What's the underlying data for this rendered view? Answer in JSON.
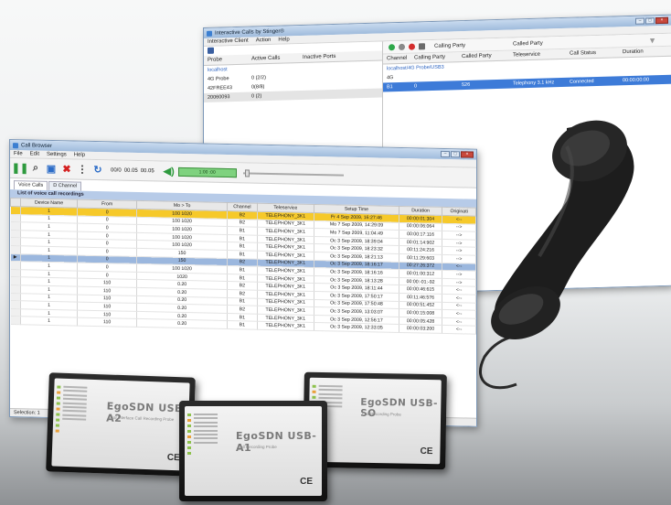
{
  "interactive": {
    "title": "Interactive Calls by Stinger®",
    "menu": [
      "Interactive Client",
      "Action",
      "Help"
    ],
    "left_headers": [
      "Probe",
      "Active Calls",
      "Inactive Ports"
    ],
    "left_rows": [
      {
        "probe": "localhost",
        "active": "",
        "inactive": ""
      },
      {
        "probe": "4G Probe",
        "active": "0 (2/2)",
        "inactive": ""
      },
      {
        "probe": "42FREE43",
        "active": "0(8/8)",
        "inactive": ""
      },
      {
        "probe": "20060093",
        "active": "0 (2)",
        "inactive": ""
      }
    ],
    "right_toolbar_label": "Calling Party",
    "right_filter_label": "Called Party",
    "right_headers": [
      "Channel",
      "Calling Party",
      "Called Party",
      "Teleservice",
      "Call Status",
      "Duration"
    ],
    "right_group": "localhost/4G Probe/USB3",
    "right_sub": "4G",
    "right_selected": {
      "channel": "B1",
      "calling": "0",
      "called": "526",
      "teleservice": "Telephony 3.1 kHz",
      "status": "Connected",
      "duration": "00:00:00:00"
    }
  },
  "callbrowser": {
    "title": "Call Browser",
    "menu": [
      "File",
      "Edit",
      "Settings",
      "Help"
    ],
    "toolbar_counters": [
      "00/0",
      "00.05",
      "00.05"
    ],
    "led_text": "1:00 :00",
    "tabs": [
      "Voice Calls",
      "D Channel"
    ],
    "grid_caption": "List of voice call recordings",
    "headers": [
      "Device Name",
      "From",
      "Mo > To",
      "Channel",
      "Teleservice",
      "Setup Time",
      "Duration",
      "Originati"
    ],
    "rows": [
      [
        "1",
        "0",
        "100 1020",
        "B2",
        "TELEPHONY_3K1",
        "Fr 4 Sep 2009, 16:27:46",
        "00:00:01:304",
        "<--",
        "hl"
      ],
      [
        "1",
        "0",
        "100 1020",
        "B2",
        "TELEPHONY_3K1",
        "Mo 7 Sep 2009, 14:29:09",
        "00:00:06:064",
        "-->",
        ""
      ],
      [
        "1",
        "0",
        "100 1020",
        "B1",
        "TELEPHONY_3K1",
        "Mo 7 Sep 2009, 11:04:49",
        "00:00:17:116",
        "-->",
        ""
      ],
      [
        "1",
        "0",
        "100 1020",
        "B1",
        "TELEPHONY_3K1",
        "Oc 3 Sep 2009, 18:39:04",
        "00:01:14:902",
        "-->",
        ""
      ],
      [
        "1",
        "0",
        "100 1020",
        "B1",
        "TELEPHONY_3K1",
        "Oc 3 Sep 2009, 18:23:32",
        "00:11:24:216",
        "-->",
        ""
      ],
      [
        "1",
        "0",
        "150",
        "B1",
        "TELEPHONY_3K1",
        "Oc 3 Sep 2009, 18:21:13",
        "00:11:29:603",
        "-->",
        ""
      ],
      [
        "1",
        "0",
        "150",
        "B2",
        "TELEPHONY_3K1",
        "Oc 3 Sep 2009, 18:16:17",
        "00:27:26:372",
        "<--",
        "sel"
      ],
      [
        "1",
        "0",
        "100 1020",
        "B1",
        "TELEPHONY_3K1",
        "Oc 3 Sep 2009, 18:16:16",
        "00:01:00:312",
        "-->",
        ""
      ],
      [
        "1",
        "0",
        "1020",
        "B1",
        "TELEPHONY_3K1",
        "Oc 3 Sep 2009, 18:13:28",
        "00:00:-01:-92",
        "-->",
        ""
      ],
      [
        "1",
        "110",
        "0.20",
        "B2",
        "TELEPHONY_3K1",
        "Oc 3 Sep 2009, 18:11:44",
        "00:00:46:615",
        "<--",
        ""
      ],
      [
        "1",
        "110",
        "0.20",
        "B2",
        "TELEPHONY_3K1",
        "Oc 3 Sep 2009, 17:50:17",
        "00:11:46:576",
        "<--",
        ""
      ],
      [
        "1",
        "110",
        "0.20",
        "B1",
        "TELEPHONY_3K1",
        "Oc 3 Sep 2009, 17:50:48",
        "00:00:51:452",
        "<--",
        ""
      ],
      [
        "1",
        "110",
        "0.20",
        "B2",
        "TELEPHONY_3K1",
        "Oc 3 Sep 2009, 13:03:07",
        "00:00:15:008",
        "<--",
        ""
      ],
      [
        "1",
        "110",
        "0.20",
        "B1",
        "TELEPHONY_3K1",
        "Oc 3 Sep 2009, 12:56:17",
        "00:00:05:428",
        "<--",
        ""
      ],
      [
        "1",
        "110",
        "0.20",
        "B1",
        "TELEPHONY_3K1",
        "Oc 3 Sep 2009, 12:33:05",
        "00:00:03:200",
        "<--",
        ""
      ]
    ],
    "status": "Selection: 1"
  },
  "devices": [
    {
      "brand": "EgoSDN USB-A2",
      "sub": "Dual Interface Call Recording Probe"
    },
    {
      "brand": "EgoSDN USB-A1",
      "sub": "Call Recording Probe"
    },
    {
      "brand": "EgoSDN USB-SO",
      "sub": "Call Recording Probe"
    }
  ],
  "colors": {
    "highlight_row": "#f6c92a",
    "selected_row": "#9bb7de",
    "titlebar": "#9fbbdc",
    "led_green": "#7fd27f"
  }
}
